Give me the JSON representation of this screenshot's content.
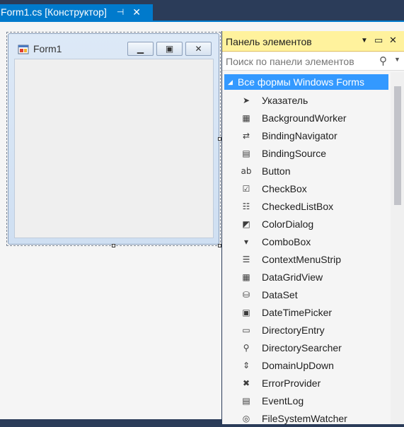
{
  "document_tab": {
    "title": "Form1.cs [Конструктор]",
    "pin_icon": "pin-icon",
    "close_icon": "close-icon"
  },
  "form": {
    "title": "Form1",
    "icon": "form-app-icon",
    "buttons": [
      "minimize-icon",
      "maximize-icon",
      "close-icon"
    ]
  },
  "toolbox": {
    "title": "Панель элементов",
    "search_placeholder": "Поиск по панели элементов",
    "group_label": "Все формы Windows Forms",
    "items": [
      {
        "label": "Указатель",
        "icon": "pointer-icon",
        "glyph": "➤"
      },
      {
        "label": "BackgroundWorker",
        "icon": "backgroundworker-icon",
        "glyph": "▦"
      },
      {
        "label": "BindingNavigator",
        "icon": "bindingnavigator-icon",
        "glyph": "⇄"
      },
      {
        "label": "BindingSource",
        "icon": "bindingsource-icon",
        "glyph": "▤"
      },
      {
        "label": "Button",
        "icon": "button-icon",
        "glyph": "ab"
      },
      {
        "label": "CheckBox",
        "icon": "checkbox-icon",
        "glyph": "☑"
      },
      {
        "label": "CheckedListBox",
        "icon": "checkedlistbox-icon",
        "glyph": "☷"
      },
      {
        "label": "ColorDialog",
        "icon": "colordialog-icon",
        "glyph": "◩"
      },
      {
        "label": "ComboBox",
        "icon": "combobox-icon",
        "glyph": "▾"
      },
      {
        "label": "ContextMenuStrip",
        "icon": "contextmenustrip-icon",
        "glyph": "☰"
      },
      {
        "label": "DataGridView",
        "icon": "datagridview-icon",
        "glyph": "▦"
      },
      {
        "label": "DataSet",
        "icon": "dataset-icon",
        "glyph": "⛁"
      },
      {
        "label": "DateTimePicker",
        "icon": "datetimepicker-icon",
        "glyph": "▣"
      },
      {
        "label": "DirectoryEntry",
        "icon": "directoryentry-icon",
        "glyph": "▭"
      },
      {
        "label": "DirectorySearcher",
        "icon": "directorysearcher-icon",
        "glyph": "⚲"
      },
      {
        "label": "DomainUpDown",
        "icon": "domainupdown-icon",
        "glyph": "⇕"
      },
      {
        "label": "ErrorProvider",
        "icon": "errorprovider-icon",
        "glyph": "✖"
      },
      {
        "label": "EventLog",
        "icon": "eventlog-icon",
        "glyph": "▤"
      },
      {
        "label": "FileSystemWatcher",
        "icon": "filesystemwatcher-icon",
        "glyph": "◎"
      }
    ]
  },
  "colors": {
    "accent": "#007acc",
    "selection": "#3399ff",
    "toolbox_header": "#fff29d"
  }
}
